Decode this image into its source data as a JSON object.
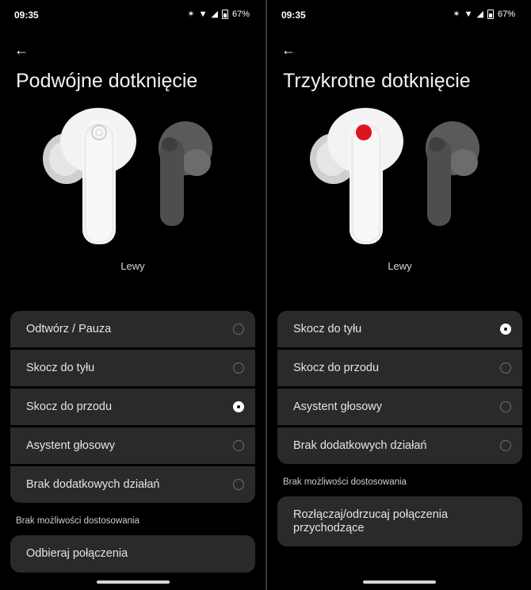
{
  "left": {
    "status": {
      "time": "09:35",
      "battery": "67%"
    },
    "title": "Podwójne dotknięcie",
    "earbud_label": "Lewy",
    "options": [
      {
        "label": "Odtwórz / Pauza",
        "selected": false
      },
      {
        "label": "Skocz do tyłu",
        "selected": false
      },
      {
        "label": "Skocz do przodu",
        "selected": true
      },
      {
        "label": "Asystent głosowy",
        "selected": false
      },
      {
        "label": "Brak dodatkowych działań",
        "selected": false
      }
    ],
    "fixed_section_label": "Brak możliwości dostosowania",
    "fixed_action": "Odbieraj połączenia"
  },
  "right": {
    "status": {
      "time": "09:35",
      "battery": "67%"
    },
    "title": "Trzykrotne dotknięcie",
    "earbud_label": "Lewy",
    "options": [
      {
        "label": "Skocz do tyłu",
        "selected": true
      },
      {
        "label": "Skocz do przodu",
        "selected": false
      },
      {
        "label": "Asystent głosowy",
        "selected": false
      },
      {
        "label": "Brak dodatkowych działań",
        "selected": false
      }
    ],
    "fixed_section_label": "Brak możliwości dostosowania",
    "fixed_action": "Rozłączaj/odrzucaj połączenia przychodzące"
  },
  "icons": {
    "back": "arrow-left-icon",
    "bluetooth": "bluetooth-icon",
    "wifi": "wifi-icon",
    "signal": "signal-icon",
    "battery": "battery-icon"
  },
  "colors": {
    "accent_touch_point": "#e0141e"
  }
}
